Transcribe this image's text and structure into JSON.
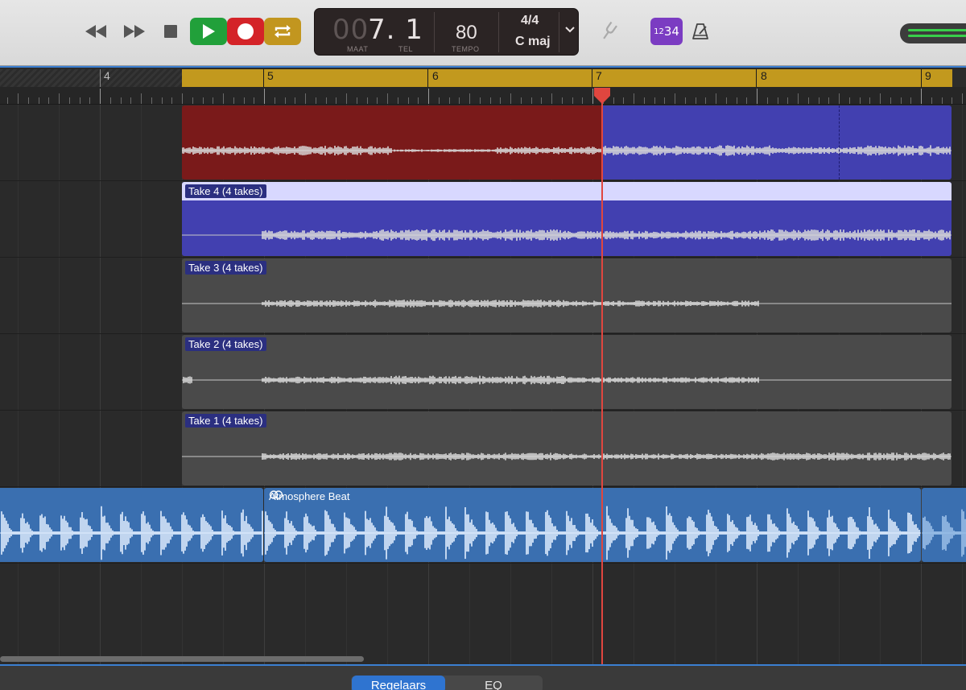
{
  "transport": {
    "rewind_icon": "rewind-icon",
    "forward_icon": "fast-forward-icon",
    "stop_icon": "stop-icon",
    "play_icon": "play-icon",
    "record_icon": "record-icon",
    "cycle_icon": "cycle-icon",
    "play_color": "#21a03a",
    "record_color": "#d42328",
    "cycle_color": "#c2961f"
  },
  "lcd": {
    "position_dim": "00",
    "position": "7. 1",
    "maat_label": "MAAT",
    "tel_label": "TEL",
    "tempo_value": "80",
    "tempo_label": "TEMPO",
    "signature": "4/4",
    "key": "C maj"
  },
  "toolbar_right": {
    "tuner_icon": "tuning-fork-icon",
    "count_in_small": "12",
    "count_in_big": "34",
    "metronome_icon": "metronome-icon",
    "count_in_color": "#7b3cc2"
  },
  "ruler": {
    "bars": [
      "4",
      "5",
      "6",
      "7",
      "8",
      "9"
    ],
    "cycle_color": "#c2991e"
  },
  "tracks": {
    "comp_colors": {
      "red": "#7a1a1a",
      "blue": "#4240b0"
    },
    "takes": [
      {
        "label": "Take 4 (4 takes)",
        "color": "#4240b0"
      },
      {
        "label": "Take 3 (4 takes)",
        "color": "#4a4a4a"
      },
      {
        "label": "Take 2 (4 takes)",
        "color": "#4a4a4a"
      },
      {
        "label": "Take 1 (4 takes)",
        "color": "#4a4a4a"
      }
    ],
    "beat_region": {
      "label": "Atmosphere Beat",
      "color": "#3a6fb0",
      "loop_icon": "loop-icon"
    }
  },
  "playhead_color": "#e0463f",
  "bottom_tabs": {
    "regelaars": "Regelaars",
    "eq": "EQ"
  }
}
